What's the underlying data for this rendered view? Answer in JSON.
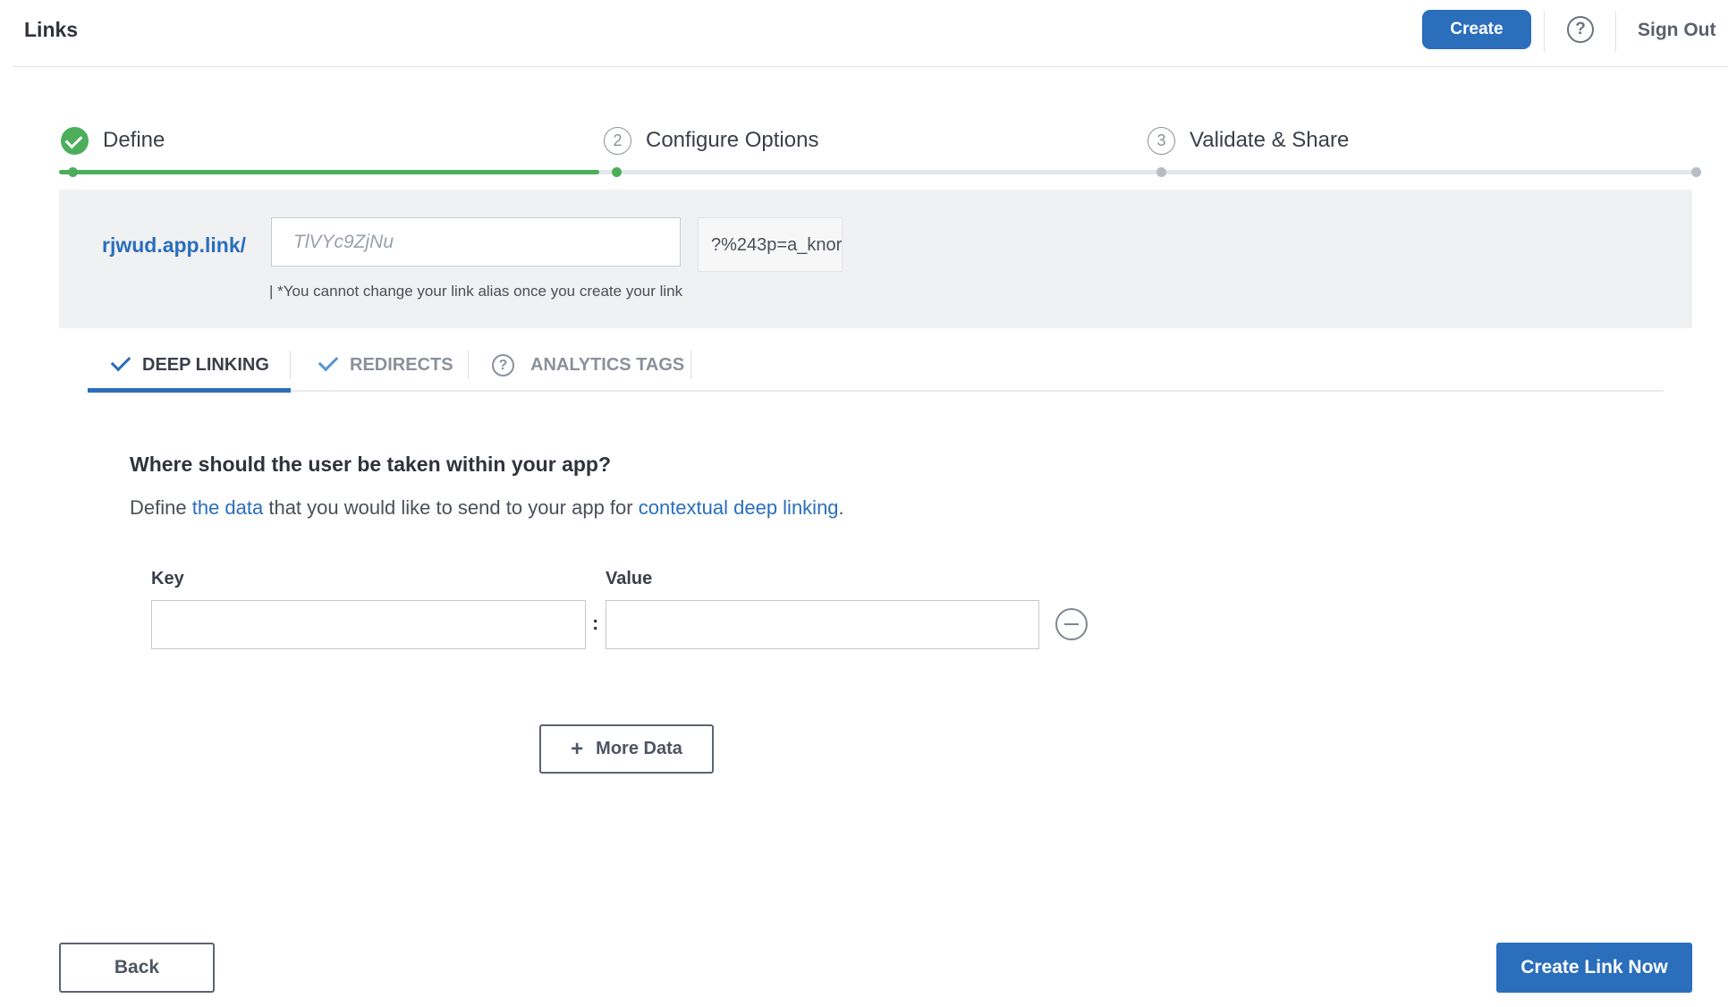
{
  "header": {
    "title": "Links",
    "create_label": "Create",
    "help_glyph": "?",
    "signout_label": "Sign Out"
  },
  "stepper": {
    "steps": [
      {
        "number": "1",
        "label": "Define",
        "status": "complete"
      },
      {
        "number": "2",
        "label": "Configure Options",
        "status": "current"
      },
      {
        "number": "3",
        "label": "Validate & Share",
        "status": "pending"
      }
    ],
    "progress_fraction": 0.33
  },
  "alias": {
    "domain": "rjwud.app.link/",
    "placeholder": "TlVYc9ZjNu",
    "value": "",
    "suffix": "?%243p=a_knorex",
    "note": "| *You cannot change your link alias once you create your link"
  },
  "tabs": [
    {
      "label": "DEEP LINKING",
      "icon": "check-icon",
      "active": true
    },
    {
      "label": "REDIRECTS",
      "icon": "check-icon",
      "active": false
    },
    {
      "label": "ANALYTICS TAGS",
      "icon": "question-circle-icon",
      "active": false
    }
  ],
  "deep_linking": {
    "question": "Where should the user be taken within your app?",
    "desc_before": "Define ",
    "desc_link1": "the data",
    "desc_middle": " that you would like to send to your app for ",
    "desc_link2": "contextual deep linking",
    "desc_after": ".",
    "key_label": "Key",
    "value_label": "Value",
    "key_value": "",
    "value_value": "",
    "separator": ":",
    "more_data_label": "More Data",
    "more_data_icon": "plus-icon"
  },
  "footer": {
    "back_label": "Back",
    "create_link_label": "Create Link Now"
  },
  "colors": {
    "accent": "#2a6ebc",
    "success": "#4cae5a",
    "panel_bg": "#f0f1f3"
  }
}
